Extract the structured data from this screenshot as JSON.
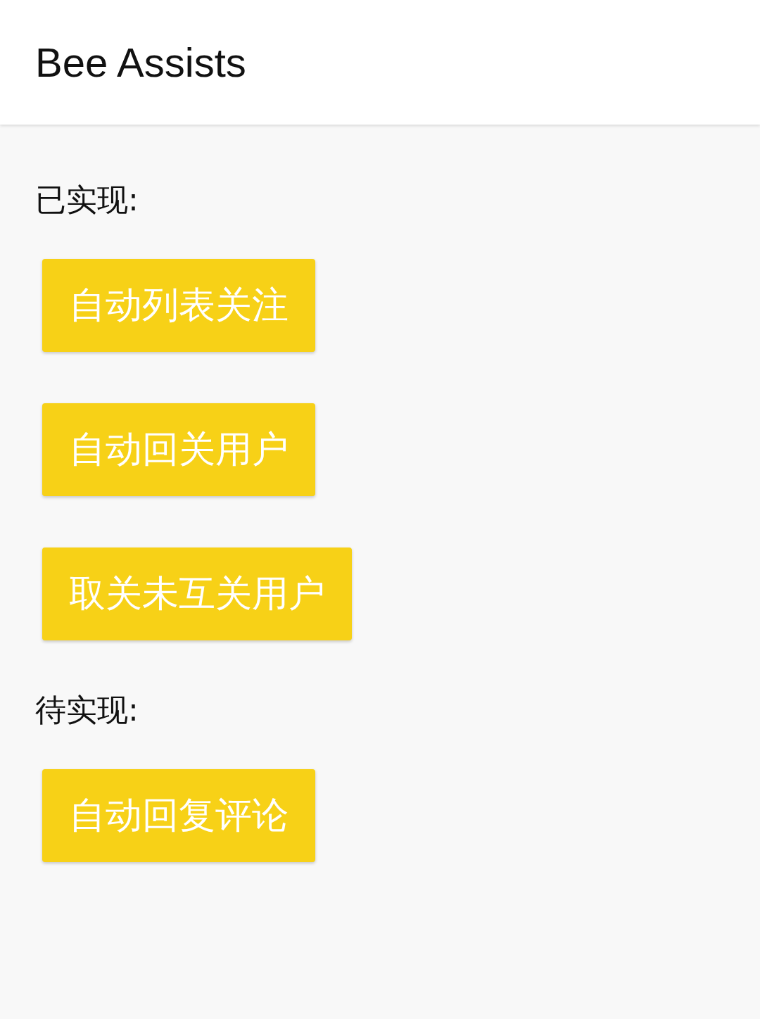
{
  "app_bar": {
    "title": "Bee Assists"
  },
  "sections": [
    {
      "heading": "已实现:",
      "buttons": [
        "自动列表关注",
        "自动回关用户",
        "取关未互关用户"
      ]
    },
    {
      "heading": "待实现:",
      "buttons": [
        "自动回复评论"
      ]
    }
  ]
}
